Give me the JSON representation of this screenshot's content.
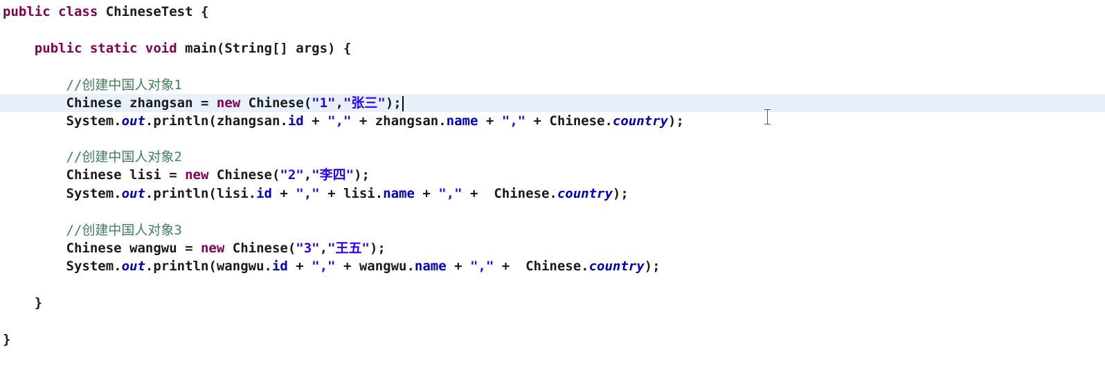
{
  "editor": {
    "lines": [
      {
        "tokens": [
          [
            "kw",
            "public "
          ],
          [
            "kw",
            "class "
          ],
          [
            "plain",
            "ChineseTest {"
          ]
        ]
      },
      {
        "tokens": []
      },
      {
        "tokens": [
          [
            "plain",
            "    "
          ],
          [
            "kw",
            "public "
          ],
          [
            "kw",
            "static "
          ],
          [
            "kw",
            "void "
          ],
          [
            "plain",
            "main(String[] args) {"
          ]
        ]
      },
      {
        "tokens": []
      },
      {
        "tokens": [
          [
            "plain",
            "        "
          ],
          [
            "comment",
            "//创建中国人对象1"
          ]
        ]
      },
      {
        "tokens": [
          [
            "plain",
            "        Chinese zhangsan = "
          ],
          [
            "kw",
            "new "
          ],
          [
            "plain",
            "Chinese("
          ],
          [
            "str",
            "\"1\""
          ],
          [
            "plain",
            ","
          ],
          [
            "str",
            "\"张三\""
          ],
          [
            "plain",
            ");"
          ]
        ],
        "current": true
      },
      {
        "tokens": [
          [
            "plain",
            "        System."
          ],
          [
            "static",
            "out"
          ],
          [
            "plain",
            ".println(zhangsan."
          ],
          [
            "field",
            "id"
          ],
          [
            "plain",
            " + "
          ],
          [
            "str",
            "\",\""
          ],
          [
            "plain",
            " + zhangsan."
          ],
          [
            "field",
            "name"
          ],
          [
            "plain",
            " + "
          ],
          [
            "str",
            "\",\""
          ],
          [
            "plain",
            " + Chinese."
          ],
          [
            "static",
            "country"
          ],
          [
            "plain",
            ");"
          ]
        ]
      },
      {
        "tokens": []
      },
      {
        "tokens": [
          [
            "plain",
            "        "
          ],
          [
            "comment",
            "//创建中国人对象2"
          ]
        ]
      },
      {
        "tokens": [
          [
            "plain",
            "        Chinese lisi = "
          ],
          [
            "kw",
            "new "
          ],
          [
            "plain",
            "Chinese("
          ],
          [
            "str",
            "\"2\""
          ],
          [
            "plain",
            ","
          ],
          [
            "str",
            "\"李四\""
          ],
          [
            "plain",
            ");"
          ]
        ]
      },
      {
        "tokens": [
          [
            "plain",
            "        System."
          ],
          [
            "static",
            "out"
          ],
          [
            "plain",
            ".println(lisi."
          ],
          [
            "field",
            "id"
          ],
          [
            "plain",
            " + "
          ],
          [
            "str",
            "\",\""
          ],
          [
            "plain",
            " + lisi."
          ],
          [
            "field",
            "name"
          ],
          [
            "plain",
            " + "
          ],
          [
            "str",
            "\",\""
          ],
          [
            "plain",
            " +  Chinese."
          ],
          [
            "static",
            "country"
          ],
          [
            "plain",
            ");"
          ]
        ]
      },
      {
        "tokens": []
      },
      {
        "tokens": [
          [
            "plain",
            "        "
          ],
          [
            "comment",
            "//创建中国人对象3"
          ]
        ]
      },
      {
        "tokens": [
          [
            "plain",
            "        Chinese wangwu = "
          ],
          [
            "kw",
            "new "
          ],
          [
            "plain",
            "Chinese("
          ],
          [
            "str",
            "\"3\""
          ],
          [
            "plain",
            ","
          ],
          [
            "str",
            "\"王五\""
          ],
          [
            "plain",
            ");"
          ]
        ]
      },
      {
        "tokens": [
          [
            "plain",
            "        System."
          ],
          [
            "static",
            "out"
          ],
          [
            "plain",
            ".println(wangwu."
          ],
          [
            "field",
            "id"
          ],
          [
            "plain",
            " + "
          ],
          [
            "str",
            "\",\""
          ],
          [
            "plain",
            " + wangwu."
          ],
          [
            "field",
            "name"
          ],
          [
            "plain",
            " + "
          ],
          [
            "str",
            "\",\""
          ],
          [
            "plain",
            " +  Chinese."
          ],
          [
            "static",
            "country"
          ],
          [
            "plain",
            ");"
          ]
        ]
      },
      {
        "tokens": []
      },
      {
        "tokens": [
          [
            "plain",
            "    }"
          ]
        ]
      },
      {
        "tokens": []
      },
      {
        "tokens": [
          [
            "plain",
            "}"
          ]
        ]
      }
    ]
  },
  "colors": {
    "keyword": "#7f0055",
    "string": "#2a00ff",
    "field": "#0000c0",
    "comment": "#3f7f5f",
    "current_line": "#e8f0fb"
  },
  "icons": {
    "text_cursor": "i-beam-cursor-icon",
    "caret": "text-caret-icon"
  }
}
